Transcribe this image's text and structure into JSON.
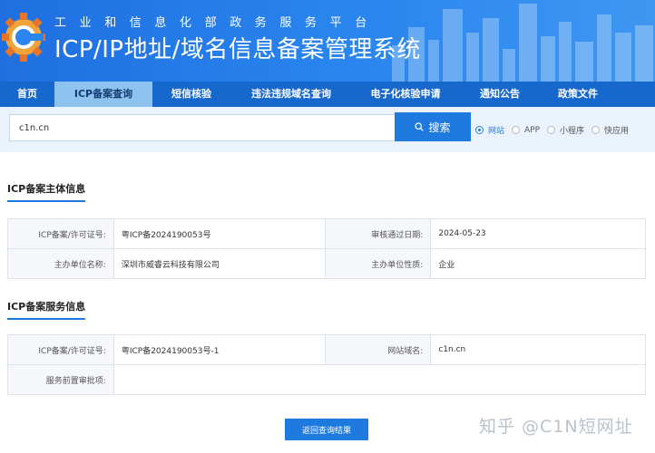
{
  "header": {
    "subtitle": "工业和信息化部政务服务平台",
    "title": "ICP/IP地址/域名信息备案管理系统"
  },
  "nav": {
    "items": [
      {
        "label": "首页",
        "active": false
      },
      {
        "label": "ICP备案查询",
        "active": true
      },
      {
        "label": "短信核验",
        "active": false
      },
      {
        "label": "违法违规域名查询",
        "active": false
      },
      {
        "label": "电子化核验申请",
        "active": false
      },
      {
        "label": "通知公告",
        "active": false
      },
      {
        "label": "政策文件",
        "active": false
      }
    ]
  },
  "search": {
    "value": "c1n.cn",
    "button_label": "搜索",
    "options": [
      "网站",
      "APP",
      "小程序",
      "快应用"
    ],
    "selected": "网站"
  },
  "subject": {
    "section_title": "ICP备案主体信息",
    "license_label": "ICP备案/许可证号:",
    "license_value": "粤ICP备2024190053号",
    "approve_date_label": "审核通过日期:",
    "approve_date_value": "2024-05-23",
    "org_name_label": "主办单位名称:",
    "org_name_value": "深圳市威睿云科技有限公司",
    "org_type_label": "主办单位性质:",
    "org_type_value": "企业"
  },
  "service": {
    "section_title": "ICP备案服务信息",
    "license_label": "ICP备案/许可证号:",
    "license_value": "粤ICP备2024190053号-1",
    "domain_label": "网站域名:",
    "domain_value": "c1n.cn",
    "pre_approval_label": "服务前置审批项:",
    "pre_approval_value": ""
  },
  "back_button_label": "返回查询结果",
  "watermark": "知乎 @C1N短网址",
  "colors": {
    "header_blue": "#2a86ee",
    "nav_blue": "#1768cc",
    "nav_active": "#8ec2ef",
    "accent": "#1f7ae0",
    "search_bg": "#eaf3fc"
  }
}
